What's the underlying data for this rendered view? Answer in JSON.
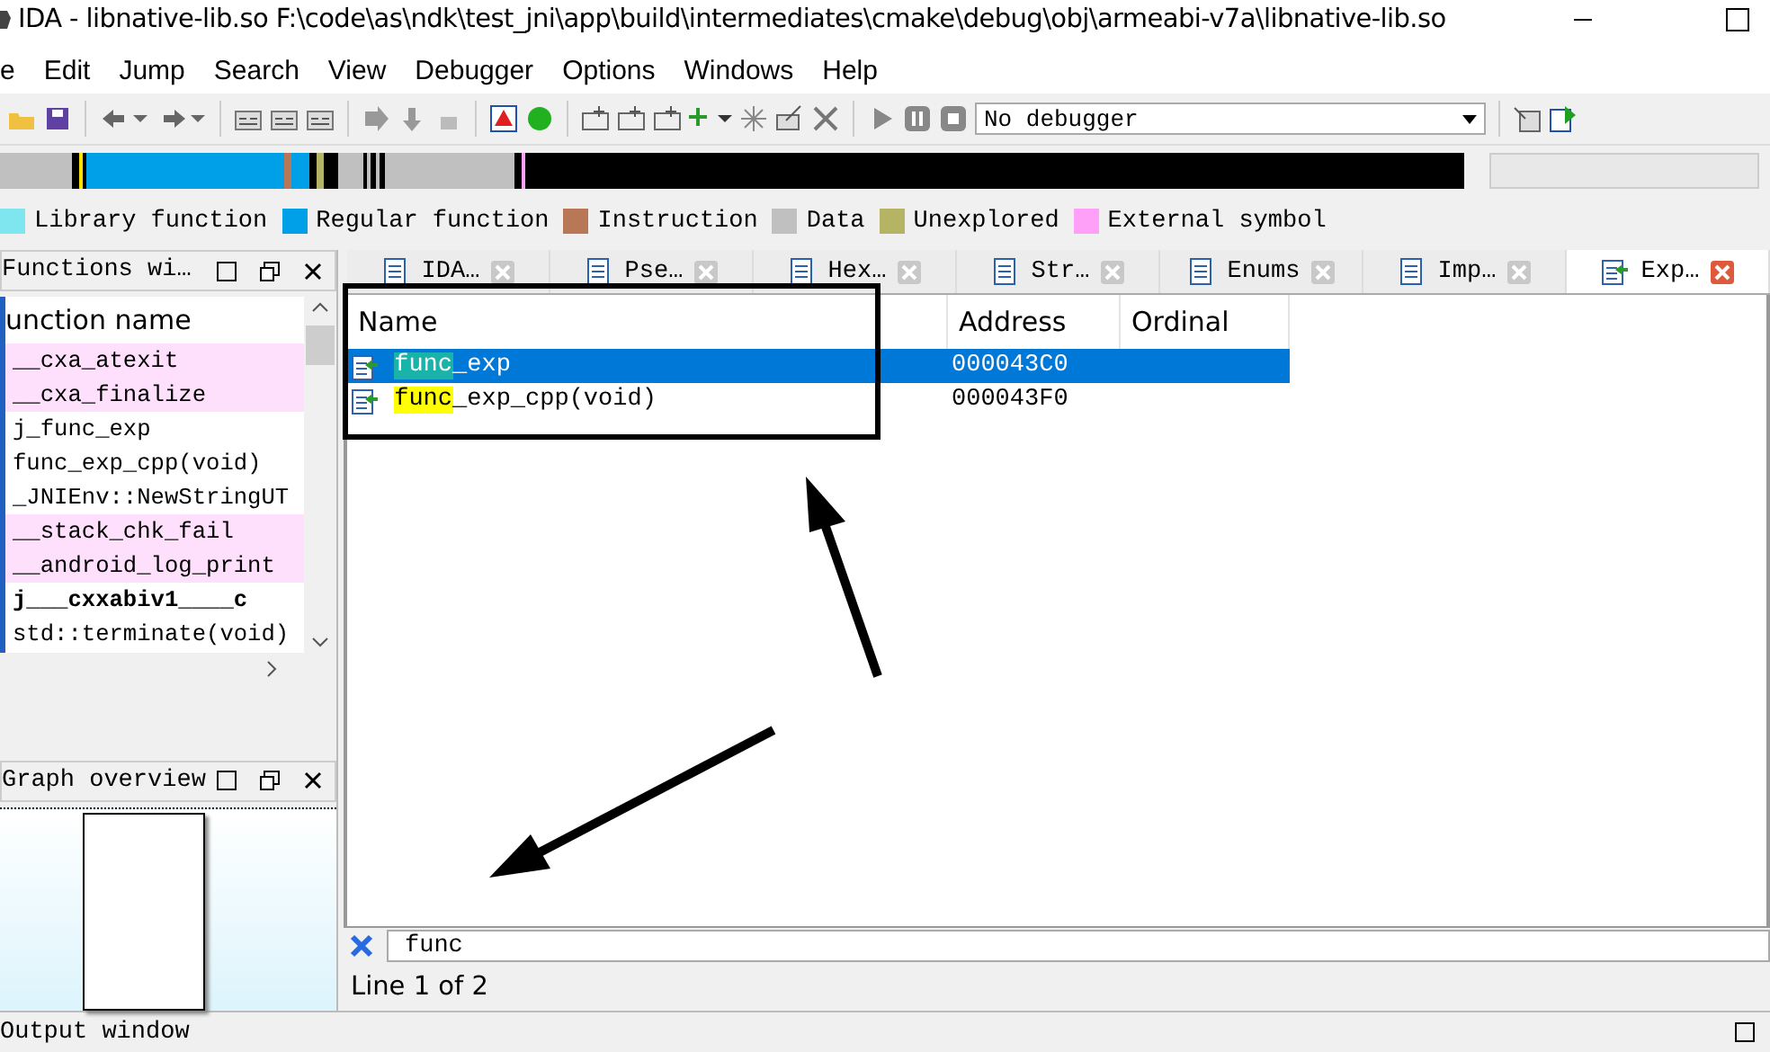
{
  "window": {
    "title": "IDA - libnative-lib.so F:\\code\\as\\ndk\\test_jni\\app\\build\\intermediates\\cmake\\debug\\obj\\armeabi-v7a\\libnative-lib.so"
  },
  "menu": [
    "e",
    "Edit",
    "Jump",
    "Search",
    "View",
    "Debugger",
    "Options",
    "Windows",
    "Help"
  ],
  "toolbar": {
    "debugger": "No debugger"
  },
  "legend": [
    {
      "label": "Library function",
      "color": "#7fe6f0"
    },
    {
      "label": "Regular function",
      "color": "#00a0e8"
    },
    {
      "label": "Instruction",
      "color": "#b87858"
    },
    {
      "label": "Data",
      "color": "#c0c0c0"
    },
    {
      "label": "Unexplored",
      "color": "#b4b464"
    },
    {
      "label": "External symbol",
      "color": "#ffa0f8"
    }
  ],
  "functions_panel": {
    "title": "Functions wi…",
    "column": "unction name",
    "rows": [
      {
        "name": "__cxa_atexit",
        "kind": "external",
        "bold": false
      },
      {
        "name": "__cxa_finalize",
        "kind": "external",
        "bold": false
      },
      {
        "name": "j_func_exp",
        "kind": "regular",
        "bold": false
      },
      {
        "name": "func_exp_cpp(void)",
        "kind": "regular",
        "bold": false
      },
      {
        "name": "_JNIEnv::NewStringUT",
        "kind": "regular",
        "bold": false
      },
      {
        "name": "__stack_chk_fail",
        "kind": "external",
        "bold": false
      },
      {
        "name": "__android_log_print",
        "kind": "external",
        "bold": false
      },
      {
        "name": "j___cxxabiv1____c",
        "kind": "regular",
        "bold": true
      },
      {
        "name": "std::terminate(void)",
        "kind": "regular",
        "bold": false
      }
    ]
  },
  "graph_panel": {
    "title": "Graph overview"
  },
  "tabs": [
    {
      "label": "IDA…",
      "selected": false
    },
    {
      "label": "Pse…",
      "selected": false
    },
    {
      "label": "Hex…",
      "selected": false
    },
    {
      "label": "Str…",
      "selected": false
    },
    {
      "label": "Enums",
      "selected": false
    },
    {
      "label": "Imp…",
      "selected": false
    },
    {
      "label": "Exp…",
      "selected": true
    }
  ],
  "exports": {
    "columns": [
      "Name",
      "Address",
      "Ordinal"
    ],
    "rows": [
      {
        "name_match": "func",
        "name_rest": "_exp",
        "address": "000043C0",
        "selected": true
      },
      {
        "name_match": "func",
        "name_rest": "_exp_cpp(void)",
        "address": "000043F0",
        "selected": false
      }
    ]
  },
  "search": {
    "value": "func"
  },
  "status": "Line 1 of 2",
  "output_panel": {
    "title": "Output window"
  }
}
